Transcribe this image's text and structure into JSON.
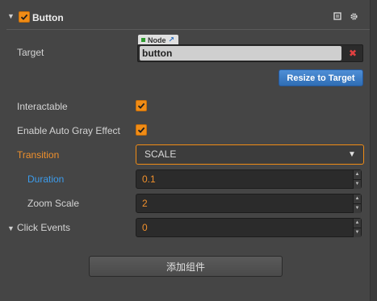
{
  "header": {
    "title": "Button",
    "enabled": true,
    "collapsed": false
  },
  "target": {
    "label": "Target",
    "tag": "Node",
    "value": "button",
    "action_label": "Resize to Target"
  },
  "interactable": {
    "label": "Interactable",
    "checked": true
  },
  "auto_gray": {
    "label": "Enable Auto Gray Effect",
    "checked": true
  },
  "transition": {
    "label": "Transition",
    "value": "SCALE"
  },
  "duration": {
    "label": "Duration",
    "value": "0.1"
  },
  "zoom_scale": {
    "label": "Zoom Scale",
    "value": "2"
  },
  "click_events": {
    "label": "Click Events",
    "value": "0"
  },
  "add_component": {
    "label": "添加组件"
  },
  "colors": {
    "accent": "#f08c16",
    "link_blue": "#3c9cec",
    "button_blue": "#3a7cc8",
    "background": "#454545"
  }
}
